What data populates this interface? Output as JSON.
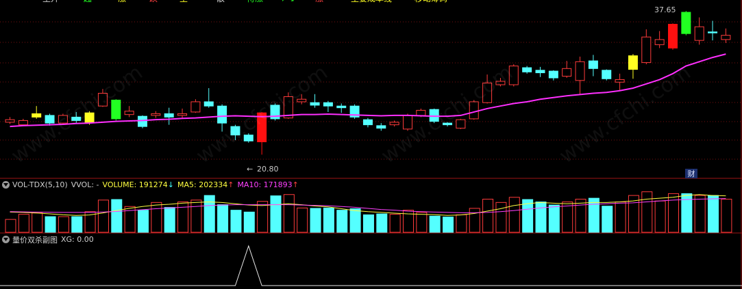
{
  "top_menu": {
    "items": [
      "主升",
      "起",
      "涨",
      "跌",
      "主",
      "散",
      "待涨",
      "↗↘",
      "涨",
      "主要成本线",
      "移动筹码"
    ]
  },
  "main_chart": {
    "high_label": "37.65",
    "low_label": "20.80",
    "low_arrow": "←",
    "finance_badge": "财",
    "watermark": "www.cfchi.com",
    "colors": {
      "up": "#ff3b3b",
      "down": "#54ffff",
      "ma": "#ff2fff",
      "signal_green": "#22ff22",
      "signal_yellow": "#ffff22",
      "signal_red": "#ff1010"
    }
  },
  "vol_panel": {
    "name": "VOL-TDX(5,10)",
    "vvol": "VVOL: -",
    "volume": "VOLUME: 191274",
    "volume_arrow": "↓",
    "ma5": "MA5: 202334",
    "ma5_arrow": "↑",
    "ma10": "MA10: 171893",
    "ma10_arrow": "↑"
  },
  "xg_panel": {
    "name": "量价双杀副图",
    "xg": "XG: 0.00"
  },
  "chart_data": {
    "type": "candlestick",
    "price_range": [
      18.5,
      38.3
    ],
    "candles": [
      {
        "o": 24.6,
        "c": 24.9,
        "h": 25.2,
        "l": 24.4
      },
      {
        "o": 24.3,
        "c": 24.8,
        "h": 25.0,
        "l": 24.2
      },
      {
        "o": 25.2,
        "c": 25.6,
        "h": 26.5,
        "l": 25.0,
        "sig": "y"
      },
      {
        "o": 25.4,
        "c": 24.5,
        "h": 25.6,
        "l": 24.2
      },
      {
        "o": 24.5,
        "c": 25.4,
        "h": 25.6,
        "l": 24.3
      },
      {
        "o": 25.2,
        "c": 24.8,
        "h": 25.8,
        "l": 24.5
      },
      {
        "o": 24.6,
        "c": 25.7,
        "h": 25.9,
        "l": 24.3,
        "sig": "y"
      },
      {
        "o": 26.5,
        "c": 28.0,
        "h": 28.5,
        "l": 26.4
      },
      {
        "o": 27.2,
        "c": 25.0,
        "h": 27.3,
        "l": 24.8,
        "sig": "g"
      },
      {
        "o": 25.5,
        "c": 25.9,
        "h": 26.5,
        "l": 25.2
      },
      {
        "o": 25.3,
        "c": 24.1,
        "h": 25.4,
        "l": 23.9
      },
      {
        "o": 25.4,
        "c": 25.6,
        "h": 25.9,
        "l": 25.1
      },
      {
        "o": 25.6,
        "c": 25.2,
        "h": 26.3,
        "l": 24.3
      },
      {
        "o": 25.4,
        "c": 25.6,
        "h": 26.2,
        "l": 25.0
      },
      {
        "o": 25.8,
        "c": 27.0,
        "h": 27.3,
        "l": 25.7
      },
      {
        "o": 27.0,
        "c": 26.5,
        "h": 28.6,
        "l": 26.3
      },
      {
        "o": 26.5,
        "c": 24.5,
        "h": 26.7,
        "l": 23.5
      },
      {
        "o": 24.1,
        "c": 23.1,
        "h": 24.3,
        "l": 22.5
      },
      {
        "o": 23.1,
        "c": 22.4,
        "h": 23.3,
        "l": 22.2
      },
      {
        "o": 22.3,
        "c": 25.7,
        "h": 25.8,
        "l": 20.8,
        "sig": "r"
      },
      {
        "o": 26.6,
        "c": 25.0,
        "h": 26.8,
        "l": 24.8
      },
      {
        "o": 25.1,
        "c": 27.6,
        "h": 28.1,
        "l": 25.0
      },
      {
        "o": 27.0,
        "c": 27.3,
        "h": 27.9,
        "l": 26.7
      },
      {
        "o": 26.9,
        "c": 26.6,
        "h": 27.9,
        "l": 26.3
      },
      {
        "o": 26.9,
        "c": 26.5,
        "h": 27.1,
        "l": 25.8
      },
      {
        "o": 26.5,
        "c": 26.3,
        "h": 26.8,
        "l": 25.7
      },
      {
        "o": 26.5,
        "c": 25.2,
        "h": 26.7,
        "l": 25.0
      },
      {
        "o": 24.9,
        "c": 24.3,
        "h": 25.1,
        "l": 24.0
      },
      {
        "o": 24.2,
        "c": 23.9,
        "h": 24.5,
        "l": 23.6
      },
      {
        "o": 24.3,
        "c": 24.6,
        "h": 24.8,
        "l": 24.1
      },
      {
        "o": 23.8,
        "c": 25.4,
        "h": 25.6,
        "l": 23.6
      },
      {
        "o": 25.4,
        "c": 26.0,
        "h": 26.2,
        "l": 25.2
      },
      {
        "o": 26.1,
        "c": 24.7,
        "h": 26.2,
        "l": 24.5
      },
      {
        "o": 24.5,
        "c": 24.3,
        "h": 24.6,
        "l": 24.1
      },
      {
        "o": 23.9,
        "c": 24.9,
        "h": 25.0,
        "l": 23.8
      },
      {
        "o": 25.0,
        "c": 27.0,
        "h": 27.2,
        "l": 24.9
      },
      {
        "o": 26.9,
        "c": 29.2,
        "h": 30.2,
        "l": 26.8
      },
      {
        "o": 29.0,
        "c": 29.4,
        "h": 29.8,
        "l": 28.8
      },
      {
        "o": 29.0,
        "c": 31.2,
        "h": 31.4,
        "l": 28.8
      },
      {
        "o": 31.0,
        "c": 30.5,
        "h": 31.2,
        "l": 30.3
      },
      {
        "o": 30.7,
        "c": 30.4,
        "h": 31.1,
        "l": 29.9
      },
      {
        "o": 30.6,
        "c": 29.8,
        "h": 30.7,
        "l": 29.5
      },
      {
        "o": 30.0,
        "c": 30.9,
        "h": 31.8,
        "l": 29.8
      },
      {
        "o": 29.5,
        "c": 31.7,
        "h": 32.3,
        "l": 27.8
      },
      {
        "o": 31.8,
        "c": 30.9,
        "h": 32.5,
        "l": 30.0
      },
      {
        "o": 30.7,
        "c": 29.7,
        "h": 30.8,
        "l": 29.5
      },
      {
        "o": 29.3,
        "c": 29.6,
        "h": 30.3,
        "l": 28.3
      },
      {
        "o": 30.8,
        "c": 32.4,
        "h": 32.6,
        "l": 29.7,
        "sig": "y"
      },
      {
        "o": 31.6,
        "c": 34.6,
        "h": 35.5,
        "l": 31.4
      },
      {
        "o": 33.7,
        "c": 34.3,
        "h": 35.3,
        "l": 33.3
      },
      {
        "o": 33.3,
        "c": 36.1,
        "h": 36.2,
        "l": 33.1,
        "sig": "r"
      },
      {
        "o": 37.5,
        "c": 35.0,
        "h": 37.65,
        "l": 34.8,
        "sig": "g"
      },
      {
        "o": 34.2,
        "c": 35.8,
        "h": 36.9,
        "l": 33.7
      },
      {
        "o": 35.2,
        "c": 35.1,
        "h": 36.5,
        "l": 34.2
      },
      {
        "o": 34.3,
        "c": 34.8,
        "h": 35.6,
        "l": 33.9
      }
    ],
    "ma_line": [
      24.1,
      24.2,
      24.25,
      24.3,
      24.35,
      24.45,
      24.5,
      24.6,
      24.7,
      24.75,
      24.8,
      24.9,
      24.95,
      25.05,
      25.1,
      25.2,
      25.3,
      25.35,
      25.3,
      25.25,
      25.3,
      25.4,
      25.5,
      25.5,
      25.55,
      25.5,
      25.45,
      25.4,
      25.35,
      25.4,
      25.4,
      25.35,
      25.3,
      25.3,
      25.4,
      25.8,
      26.2,
      26.5,
      26.8,
      27.0,
      27.3,
      27.5,
      27.7,
      27.85,
      28.0,
      28.1,
      28.3,
      28.6,
      29.1,
      29.6,
      30.3,
      31.2,
      31.7,
      32.2,
      32.6
    ],
    "volume": [
      70,
      98,
      105,
      85,
      85,
      85,
      112,
      175,
      178,
      140,
      120,
      162,
      135,
      165,
      175,
      200,
      150,
      120,
      110,
      168,
      198,
      205,
      132,
      130,
      132,
      120,
      128,
      95,
      100,
      98,
      120,
      108,
      88,
      83,
      95,
      130,
      180,
      162,
      190,
      178,
      165,
      148,
      165,
      180,
      185,
      142,
      165,
      200,
      220,
      170,
      210,
      210,
      200,
      200,
      180
    ],
    "vol_ma5": [
      110,
      108,
      105,
      100,
      95,
      92,
      94,
      105,
      118,
      130,
      140,
      148,
      152,
      158,
      162,
      165,
      162,
      155,
      148,
      145,
      150,
      155,
      150,
      143,
      138,
      128,
      118,
      112,
      108,
      104,
      100,
      98,
      96,
      92,
      94,
      102,
      115,
      128,
      145,
      155,
      162,
      158,
      155,
      158,
      162,
      162,
      165,
      170,
      180,
      185,
      190,
      200,
      205,
      200,
      198
    ],
    "vol_ma10": [
      112,
      111,
      110,
      109,
      108,
      108,
      108,
      110,
      113,
      118,
      123,
      128,
      132,
      136,
      140,
      145,
      148,
      150,
      150,
      150,
      150,
      150,
      148,
      146,
      144,
      140,
      136,
      130,
      124,
      120,
      115,
      112,
      110,
      108,
      106,
      106,
      108,
      112,
      118,
      125,
      132,
      138,
      143,
      148,
      152,
      155,
      158,
      160,
      165,
      170,
      175,
      178,
      180,
      182,
      183
    ],
    "xg_values": [
      0,
      0,
      0,
      0,
      0,
      0,
      0,
      0,
      0,
      0,
      0,
      0,
      0,
      0,
      0,
      0,
      0,
      0,
      1,
      0,
      0,
      0,
      0,
      0,
      0,
      0,
      0,
      0,
      0,
      0,
      0,
      0,
      0,
      0,
      0,
      0,
      0,
      0,
      0,
      0,
      0,
      0,
      0,
      0,
      0,
      0,
      0,
      0,
      0,
      0,
      0,
      0,
      0,
      0,
      0
    ]
  }
}
